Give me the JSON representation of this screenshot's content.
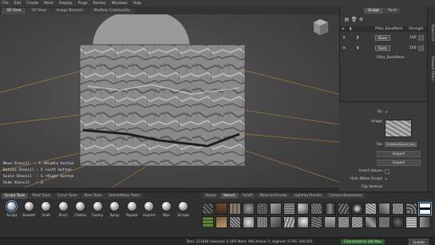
{
  "menu": [
    "File",
    "Edit",
    "Create",
    "Mesh",
    "Display",
    "Plugs",
    "Render",
    "Windows",
    "Help"
  ],
  "view_tabs": [
    {
      "label": "3D View",
      "active": true
    },
    {
      "label": "UV View",
      "active": false
    },
    {
      "label": "Image Browser",
      "active": false
    },
    {
      "label": "Mudbox Community",
      "active": false
    }
  ],
  "stencil_help": {
    "move": "Move Stencil  : S +Middle button",
    "rotate": "Rotate Stencil : S +Left button",
    "scale": "Scale Stencil  : S +Right button",
    "hide": "Hide Stencil   : Q"
  },
  "right_panel": {
    "tabs": [
      {
        "label": "Sculpt",
        "active": true
      },
      {
        "label": "Paint",
        "active": false
      }
    ],
    "layer_header": {
      "name": "Pillar_BaseMesh",
      "strength": "Strength"
    },
    "layers": [
      {
        "name": "Base",
        "value": "100"
      },
      {
        "name": "Rock",
        "value": "100"
      }
    ],
    "mesh_name": "Pillar_BaseMesh",
    "side_tabs": [
      "Object List",
      "Viewport Filters"
    ]
  },
  "stencil_props": {
    "on_label": "On",
    "image_label": "Image",
    "file_label": "File",
    "file_value": "D:\\stencils\\rock_tile_006.tif",
    "import_label": "Import",
    "export_label": "Export",
    "invert_label": "Invert Values",
    "hide_sculpt_label": "Hide When Sculpt",
    "flip_label": "Flip Vertical"
  },
  "shelf_tabs": [
    {
      "label": "Sculpt Tools",
      "active": true
    },
    {
      "label": "Paint Tools",
      "active": false
    },
    {
      "label": "Curve Tools",
      "active": false
    },
    {
      "label": "Pose Tools",
      "active": false
    },
    {
      "label": "Select/Move Tools",
      "active": false
    }
  ],
  "tools": [
    {
      "label": "Sculpt",
      "selected": true
    },
    {
      "label": "Smooth",
      "selected": false
    },
    {
      "label": "Grab",
      "selected": false
    },
    {
      "label": "Pinch",
      "selected": false
    },
    {
      "label": "Flatten",
      "selected": false
    },
    {
      "label": "Foamy",
      "selected": false
    },
    {
      "label": "Spray",
      "selected": false
    },
    {
      "label": "Repeat",
      "selected": false
    },
    {
      "label": "Imprint",
      "selected": false
    },
    {
      "label": "Wax",
      "selected": false
    },
    {
      "label": "Scrape",
      "selected": false
    }
  ],
  "stencil_tabs": [
    {
      "label": "Stamp",
      "active": false
    },
    {
      "label": "Stencil",
      "active": true
    },
    {
      "label": "Falloff",
      "active": false
    },
    {
      "label": "Material Presets",
      "active": false
    },
    {
      "label": "Lighting Presets",
      "active": false
    },
    {
      "label": "Camera Bookmarks",
      "active": false
    }
  ],
  "status": {
    "info": "Total: 211648   Selected: 0   GPU Mem: 960   Active: 5, Highest: 5   FPS: 246.001",
    "connection": "Connected to 3ds Max",
    "update": "Update"
  },
  "colors": {
    "accent": "#5aa0e0",
    "connected": "#2f5e2f",
    "grid": "#c8a030"
  }
}
